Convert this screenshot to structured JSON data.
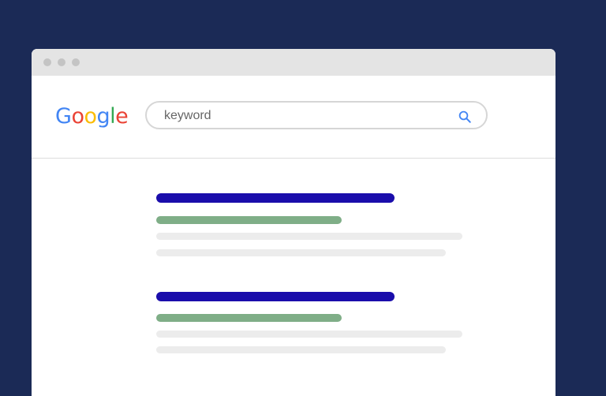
{
  "browser": {
    "window_dots": [
      "close-dot",
      "minimize-dot",
      "maximize-dot"
    ]
  },
  "header": {
    "logo_letters": [
      {
        "char": "G",
        "color": "#4285F4"
      },
      {
        "char": "o",
        "color": "#EA4335"
      },
      {
        "char": "o",
        "color": "#FBBC05"
      },
      {
        "char": "g",
        "color": "#4285F4"
      },
      {
        "char": "l",
        "color": "#34A853"
      },
      {
        "char": "e",
        "color": "#EA4335"
      }
    ],
    "search": {
      "placeholder": "keyword",
      "icon": "search-icon"
    }
  },
  "results": {
    "count": 2,
    "colors": {
      "title": "#1a0dab",
      "url": "#7fae87",
      "snippet": "#ececec"
    }
  }
}
